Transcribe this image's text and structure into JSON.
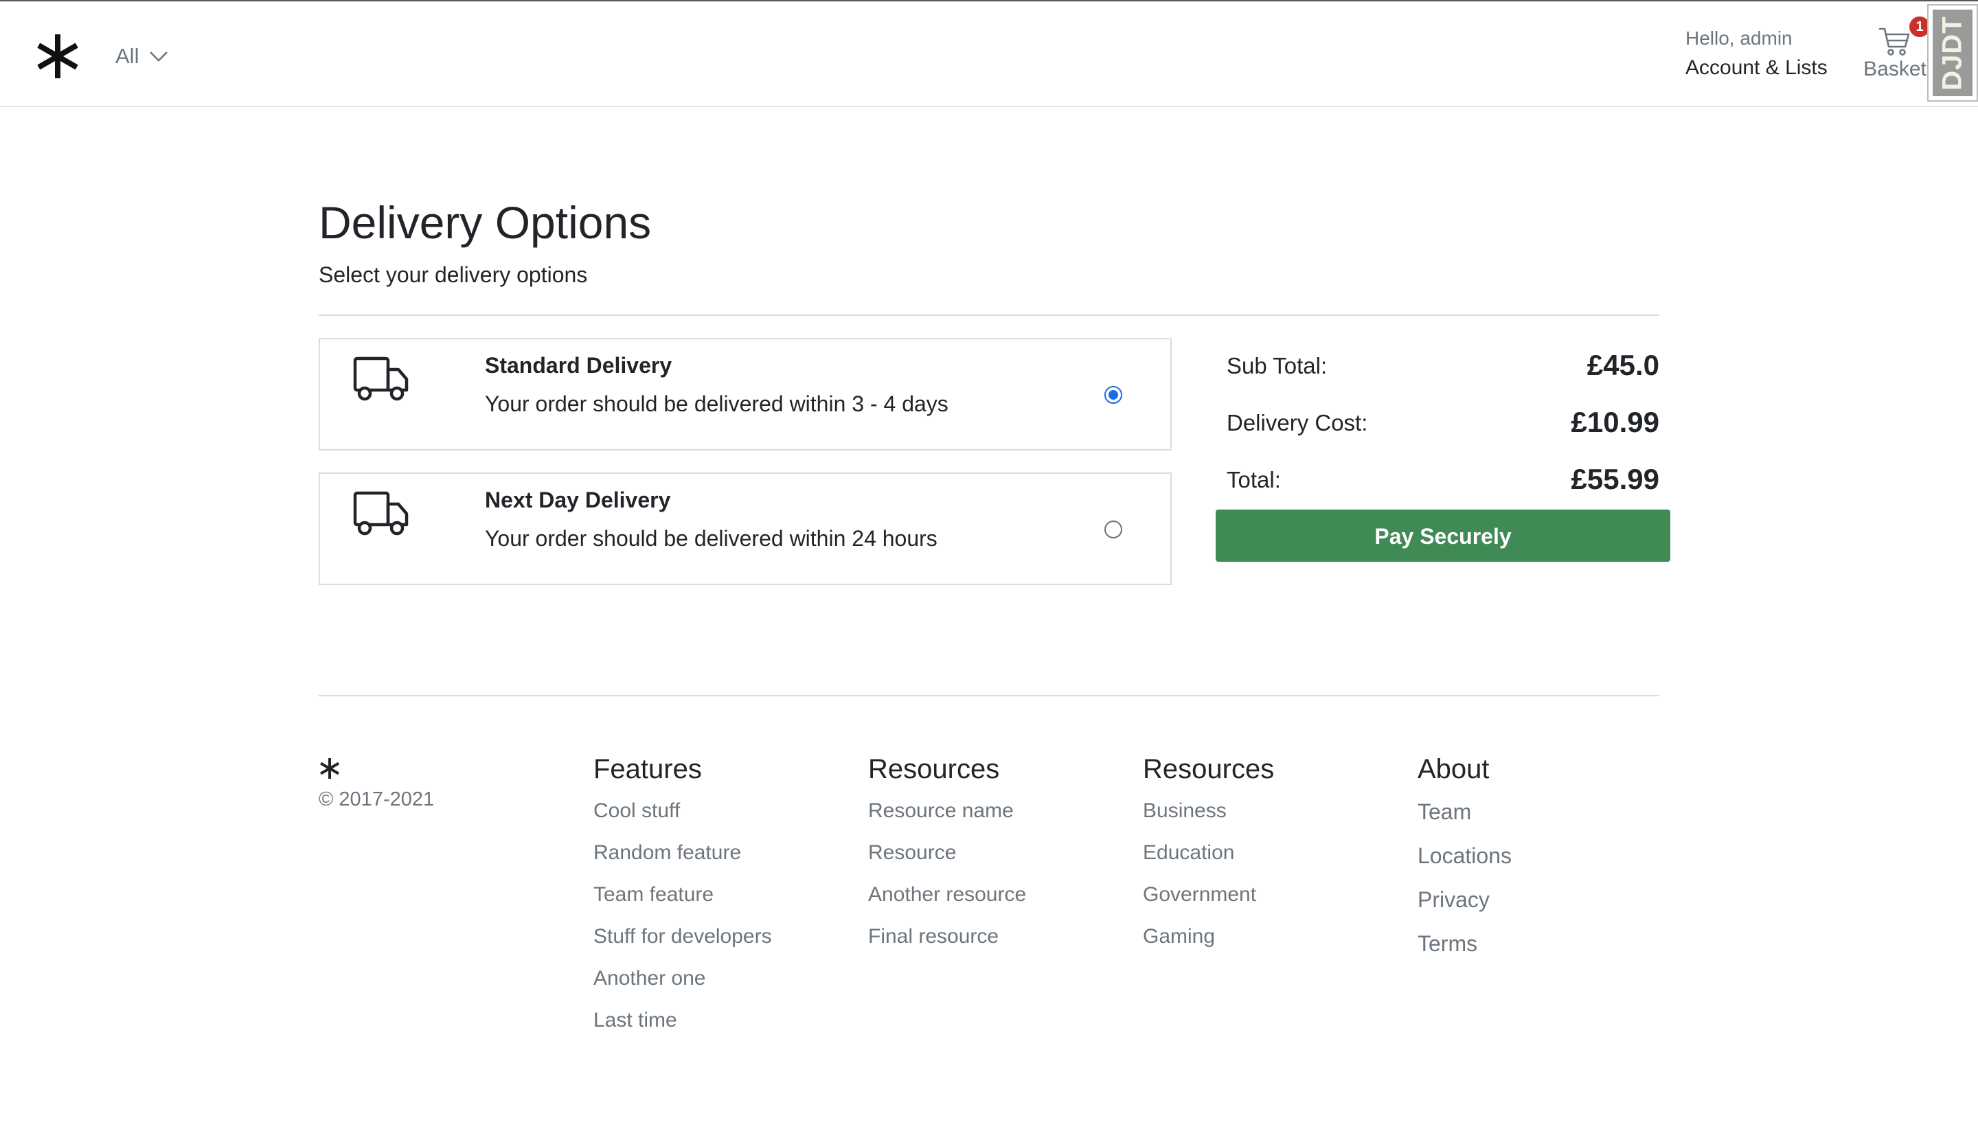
{
  "header": {
    "category": "All",
    "greeting": "Hello, admin",
    "account_link": "Account & Lists",
    "basket_label": "Basket",
    "basket_count": "1",
    "debug_toolbar_label": "DJDT"
  },
  "page": {
    "title": "Delivery Options",
    "subtitle": "Select your delivery options"
  },
  "delivery_options": [
    {
      "title": "Standard Delivery",
      "description": "Your order should be delivered within 3 - 4 days",
      "selected": true
    },
    {
      "title": "Next Day Delivery",
      "description": "Your order should be delivered within 24 hours",
      "selected": false
    }
  ],
  "summary": {
    "subtotal_label": "Sub Total:",
    "subtotal_value": "£45.0",
    "delivery_label": "Delivery Cost:",
    "delivery_value": "£10.99",
    "total_label": "Total:",
    "total_value": "£55.99",
    "pay_button": "Pay Securely"
  },
  "footer": {
    "copyright": "© 2017-2021",
    "columns": [
      {
        "heading": "Features",
        "links": [
          "Cool stuff",
          "Random feature",
          "Team feature",
          "Stuff for developers",
          "Another one",
          "Last time"
        ]
      },
      {
        "heading": "Resources",
        "links": [
          "Resource name",
          "Resource",
          "Another resource",
          "Final resource"
        ]
      },
      {
        "heading": "Resources",
        "links": [
          "Business",
          "Education",
          "Government",
          "Gaming"
        ]
      },
      {
        "heading": "About",
        "links": [
          "Team",
          "Locations",
          "Privacy",
          "Terms"
        ]
      }
    ]
  },
  "colors": {
    "pay_button": "#3f8a55",
    "radio_selected": "#1a6be6",
    "badge": "#c9302c"
  },
  "icons": {
    "logo": "asterisk-logo-icon",
    "dropdown": "chevron-down-icon",
    "cart": "cart-icon",
    "delivery": "truck-icon"
  }
}
